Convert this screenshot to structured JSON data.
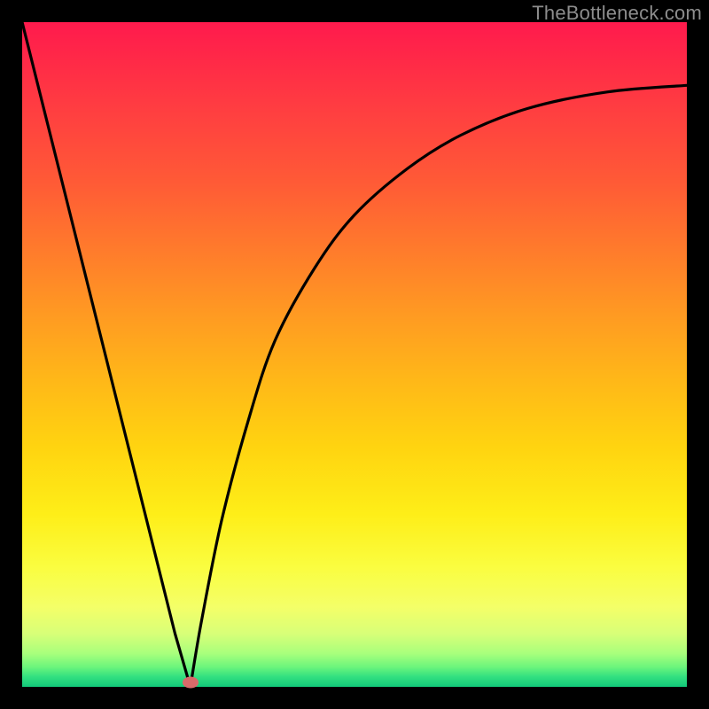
{
  "watermark": "TheBottleneck.com",
  "marker": {
    "x_pct": 25.3,
    "y_pct": 99.3,
    "color": "#d86a6a"
  },
  "chart_data": {
    "type": "line",
    "title": "",
    "xlabel": "",
    "ylabel": "",
    "xlim": [
      0,
      100
    ],
    "ylim": [
      0,
      100
    ],
    "grid": false,
    "legend": false,
    "gradient": {
      "top": "#ff1a4d",
      "bottom": "#12c87a",
      "description": "vertical red-to-green background"
    },
    "series": [
      {
        "name": "left-branch",
        "x": [
          0,
          5,
          10,
          15,
          20,
          23,
          25.3
        ],
        "y": [
          100,
          80,
          60,
          40,
          20,
          8,
          0
        ]
      },
      {
        "name": "right-branch",
        "x": [
          25.3,
          27,
          30,
          34,
          38,
          44,
          50,
          58,
          66,
          76,
          88,
          100
        ],
        "y": [
          0,
          10,
          25,
          40,
          52,
          63,
          71,
          78,
          83,
          87,
          89.5,
          90.5
        ]
      }
    ],
    "marker_point": {
      "x": 25.3,
      "y": 0
    }
  }
}
